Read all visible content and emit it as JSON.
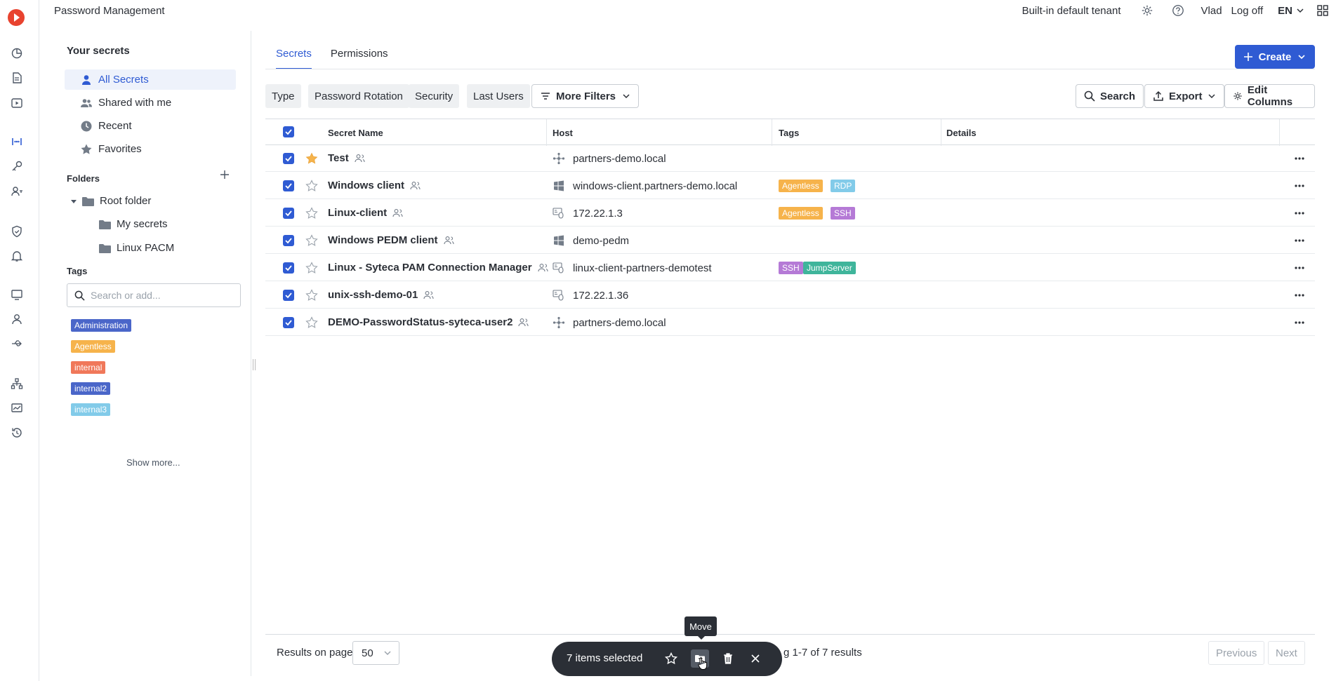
{
  "app": {
    "title": "Password Management"
  },
  "topbar": {
    "tenant": "Built-in default tenant",
    "user": "Vlad",
    "logoff": "Log off",
    "lang": "EN"
  },
  "iconbar": {
    "icons": [
      "dashboard-icon",
      "document-icon",
      "play-icon",
      "password-icon",
      "key-icon",
      "user-key-icon",
      "shield-icon",
      "bell-icon",
      "monitor-icon",
      "user-icon",
      "usb-icon",
      "network-icon",
      "chart-icon",
      "history-icon"
    ]
  },
  "sidebar": {
    "title": "Your secrets",
    "items": [
      {
        "label": "All Secrets"
      },
      {
        "label": "Shared with me"
      },
      {
        "label": "Recent"
      },
      {
        "label": "Favorites"
      }
    ],
    "folders_title": "Folders",
    "folders": [
      "Root folder",
      "My secrets",
      "Linux PACM"
    ],
    "tags_title": "Tags",
    "tags_search_placeholder": "Search or add...",
    "tags": [
      {
        "label": "Administration",
        "color": "#4a66c9"
      },
      {
        "label": "Agentless",
        "color": "#f6b34b"
      },
      {
        "label": "internal",
        "color": "#f0785a"
      },
      {
        "label": "internal2",
        "color": "#4a66c9"
      },
      {
        "label": "internal3",
        "color": "#82cbe9"
      }
    ],
    "show_more": "Show more..."
  },
  "main": {
    "tabs": [
      "Secrets",
      "Permissions"
    ],
    "create_label": "Create",
    "filters": [
      "Type",
      "Password Rotation",
      "Security",
      "Last Users"
    ],
    "more_filters": "More Filters",
    "search_label": "Search",
    "export_label": "Export",
    "edit_columns_label": "Edit Columns",
    "columns": [
      "Secret Name",
      "Host",
      "Tags",
      "Details"
    ],
    "rows": [
      {
        "name": "Test",
        "host": "partners-demo.local",
        "host_icon": "network-icon",
        "favorite": true,
        "tags": []
      },
      {
        "name": "Windows client",
        "host": "windows-client.partners-demo.local",
        "host_icon": "windows-icon",
        "favorite": false,
        "tags": [
          {
            "label": "Agentless",
            "color": "#f6b34b"
          },
          {
            "label": "RDP",
            "color": "#82cbe9"
          }
        ]
      },
      {
        "name": "Linux-client",
        "host": "172.22.1.3",
        "host_icon": "ssh-icon",
        "favorite": false,
        "tags": [
          {
            "label": "Agentless",
            "color": "#f6b34b"
          },
          {
            "label": "SSH",
            "color": "#b57ad6"
          }
        ]
      },
      {
        "name": "Windows PEDM client",
        "host": "demo-pedm",
        "host_icon": "windows-icon",
        "favorite": false,
        "tags": []
      },
      {
        "name": "Linux - Syteca PAM Connection Manager",
        "host": "linux-client-partners-demotest",
        "host_icon": "ssh-icon",
        "favorite": false,
        "tags": [
          {
            "label": "SSH",
            "color": "#b57ad6"
          },
          {
            "label": "JumpServer",
            "color": "#3fb59b"
          }
        ]
      },
      {
        "name": "unix-ssh-demo-01",
        "host": "172.22.1.36",
        "host_icon": "ssh-icon",
        "favorite": false,
        "tags": []
      },
      {
        "name": "DEMO-PasswordStatus-syteca-user2",
        "host": "partners-demo.local",
        "host_icon": "network-icon",
        "favorite": false,
        "tags": []
      }
    ]
  },
  "footer": {
    "results_on_page": "Results on page",
    "page_size": "50",
    "results_text": "g 1-7 of 7 results",
    "previous": "Previous",
    "next": "Next"
  },
  "selection": {
    "count_text": "7 items selected",
    "tooltip": "Move"
  },
  "colors": {
    "accent": "#2f5bd3",
    "dark": "#2b2f36"
  }
}
